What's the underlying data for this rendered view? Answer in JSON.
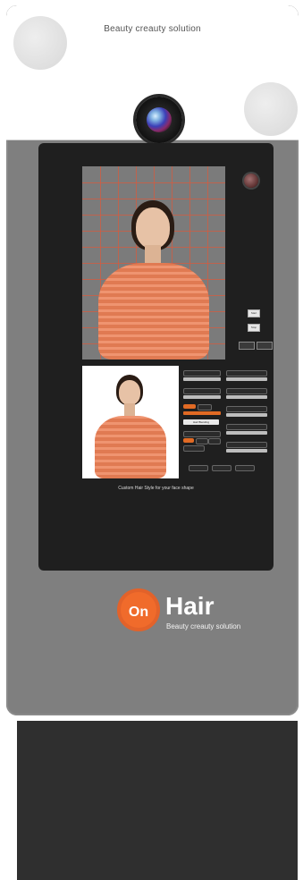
{
  "header": {
    "tagline": "Beauty creauty solution"
  },
  "screen": {
    "caption": "Custom Hair Style for your face shape",
    "side_buttons": [
      "Start",
      "Stop"
    ],
    "bottom_buttons": [
      "",
      ""
    ],
    "controls": {
      "labels": [
        "",
        "",
        "",
        "",
        "",
        "",
        "Hair Blending",
        "",
        ""
      ],
      "footer_buttons": [
        "",
        "",
        ""
      ]
    }
  },
  "brand": {
    "logo_mark": "On",
    "logo_word": "Hair",
    "subtitle": "Beauty creauty solution"
  },
  "colors": {
    "accent": "#e2622a",
    "body": "#7f7f7f",
    "screen": "#1f1f1f",
    "base": "#2f2f2f"
  }
}
